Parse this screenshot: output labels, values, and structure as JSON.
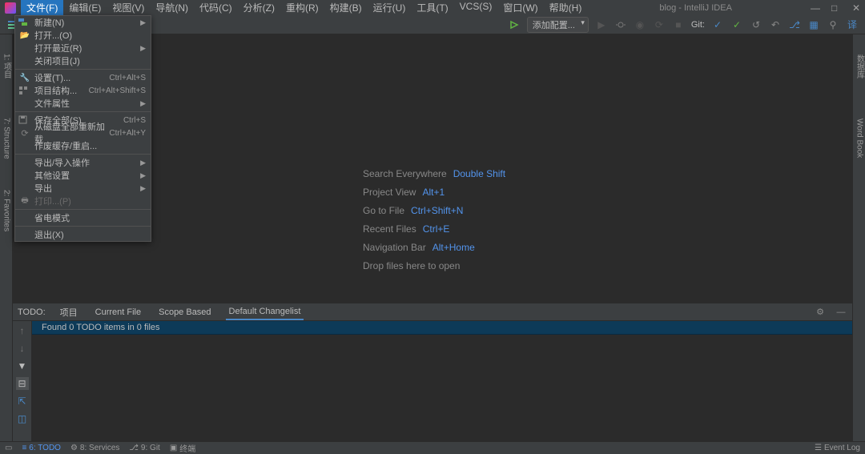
{
  "window": {
    "title": "blog - IntelliJ IDEA"
  },
  "menubar": [
    {
      "label": "文件(F)",
      "active": true
    },
    {
      "label": "编辑(E)"
    },
    {
      "label": "视图(V)"
    },
    {
      "label": "导航(N)"
    },
    {
      "label": "代码(C)"
    },
    {
      "label": "分析(Z)"
    },
    {
      "label": "重构(R)"
    },
    {
      "label": "构建(B)"
    },
    {
      "label": "运行(U)"
    },
    {
      "label": "工具(T)"
    },
    {
      "label": "VCS(S)"
    },
    {
      "label": "窗口(W)"
    },
    {
      "label": "帮助(H)"
    }
  ],
  "toolbar": {
    "run_config": "添加配置...",
    "git_label": "Git:"
  },
  "file_menu": [
    {
      "icon": "folder-tree",
      "label": "新建(N)",
      "arrow": true,
      "shortcut": ""
    },
    {
      "icon": "folder-open",
      "label": "打开...(O)",
      "shortcut": ""
    },
    {
      "icon": "",
      "label": "打开最近(R)",
      "arrow": true,
      "shortcut": ""
    },
    {
      "icon": "",
      "label": "关闭项目(J)",
      "shortcut": ""
    },
    {
      "sep": true
    },
    {
      "icon": "wrench",
      "label": "设置(T)...",
      "shortcut": "Ctrl+Alt+S"
    },
    {
      "icon": "structure",
      "label": "项目结构...",
      "shortcut": "Ctrl+Alt+Shift+S"
    },
    {
      "icon": "",
      "label": "文件属性",
      "arrow": true,
      "shortcut": ""
    },
    {
      "sep": true
    },
    {
      "icon": "save-all",
      "label": "保存全部(S)",
      "shortcut": "Ctrl+S"
    },
    {
      "icon": "reload",
      "label": "从磁盘全部重新加载",
      "shortcut": "Ctrl+Alt+Y"
    },
    {
      "icon": "",
      "label": "作废缓存/重启...",
      "shortcut": ""
    },
    {
      "sep": true
    },
    {
      "icon": "",
      "label": "导出/导入操作",
      "arrow": true,
      "shortcut": ""
    },
    {
      "icon": "",
      "label": "其他设置",
      "arrow": true,
      "shortcut": ""
    },
    {
      "icon": "",
      "label": "导出",
      "arrow": true,
      "shortcut": ""
    },
    {
      "icon": "print",
      "label": "打印...(P)",
      "shortcut": "",
      "disabled": true
    },
    {
      "sep": true
    },
    {
      "icon": "",
      "label": "省电模式",
      "shortcut": ""
    },
    {
      "sep": true
    },
    {
      "icon": "",
      "label": "退出(X)",
      "shortcut": ""
    }
  ],
  "hints": [
    {
      "label": "Search Everywhere",
      "key": "Double Shift"
    },
    {
      "label": "Project View",
      "key": "Alt+1"
    },
    {
      "label": "Go to File",
      "key": "Ctrl+Shift+N"
    },
    {
      "label": "Recent Files",
      "key": "Ctrl+E"
    },
    {
      "label": "Navigation Bar",
      "key": "Alt+Home"
    },
    {
      "label": "Drop files here to open",
      "key": ""
    }
  ],
  "left_tools": [
    {
      "label": "1: 项目"
    },
    {
      "label": "7: Structure"
    },
    {
      "label": "2: Favorites"
    }
  ],
  "right_tools": [
    {
      "label": "数据库"
    },
    {
      "label": "Word Book"
    }
  ],
  "todo": {
    "label": "TODO:",
    "tabs": [
      "项目",
      "Current File",
      "Scope Based",
      "Default Changelist"
    ],
    "active_tab": 3,
    "message": "Found 0 TODO items in 0 files"
  },
  "statusbar": {
    "items": [
      {
        "label": "6: TODO",
        "active": true,
        "icon": "≡"
      },
      {
        "label": "8: Services",
        "icon": "⚙"
      },
      {
        "label": "9: Git",
        "icon": "⎇"
      },
      {
        "label": "终端",
        "icon": "▣"
      }
    ],
    "right": [
      {
        "label": "Event Log",
        "icon": "☰"
      }
    ]
  }
}
